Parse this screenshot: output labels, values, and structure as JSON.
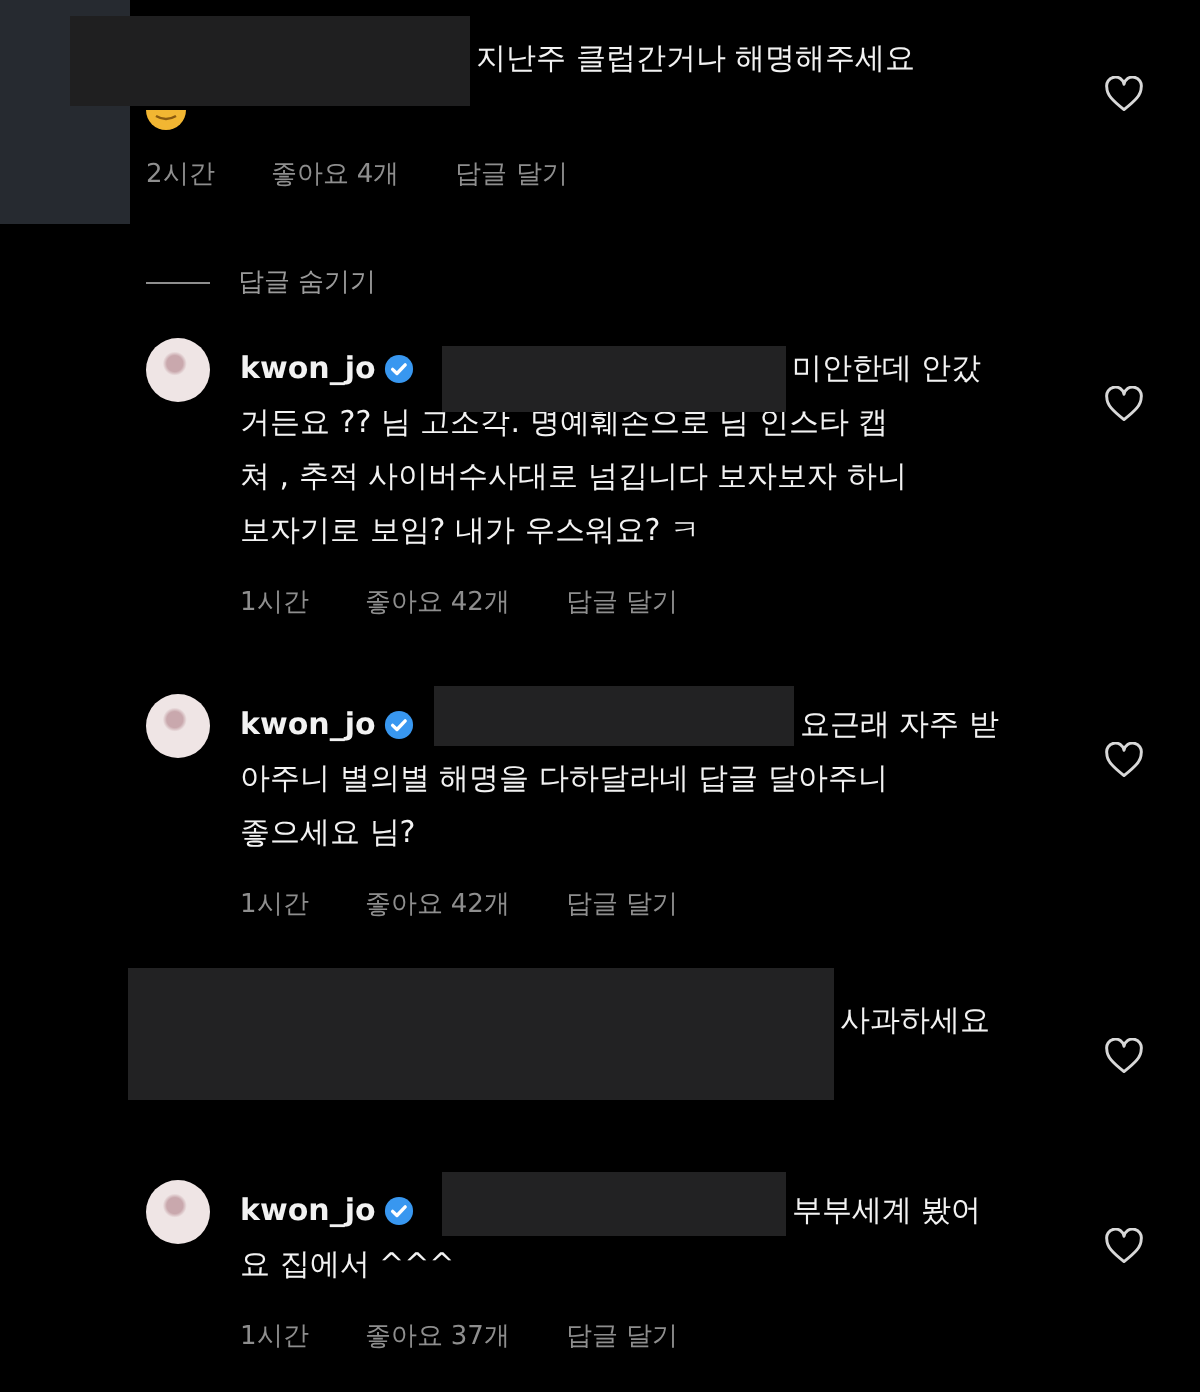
{
  "items": [
    {
      "kind": "comment",
      "text_start": "지난주 클럽간거나 해명해주세요",
      "time": "2시간",
      "likes": "좋아요 4개",
      "reply_action": "답글 달기"
    },
    {
      "kind": "hide-replies",
      "label": "답글 숨기기"
    },
    {
      "kind": "reply",
      "username": "kwon_jo",
      "verified": true,
      "text_start": "미안한데 안갔",
      "text": "거든요 ?? 님 고소각. 명예훼손으로 님 인스타 캡\n쳐 , 추적 사이버수사대로 넘깁니다 보자보자 하니\n보자기로 보임? 내가 우스워요? ㅋ",
      "time": "1시간",
      "likes": "좋아요 42개",
      "reply_action": "답글 달기"
    },
    {
      "kind": "reply",
      "username": "kwon_jo",
      "verified": true,
      "text_start": "요근래 자주 받",
      "text": "아주니  별의별 해명을 다하달라네 답글 달아주니\n좋으세요 님?",
      "time": "1시간",
      "likes": "좋아요 42개",
      "reply_action": "답글 달기"
    },
    {
      "kind": "reply",
      "text_start": "사과하세요"
    },
    {
      "kind": "reply",
      "username": "kwon_jo",
      "verified": true,
      "text_start": "부부세계 봤어",
      "text": "요 집에서 ^^^",
      "time": "1시간",
      "likes": "좋아요 37개",
      "reply_action": "답글 달기"
    }
  ]
}
